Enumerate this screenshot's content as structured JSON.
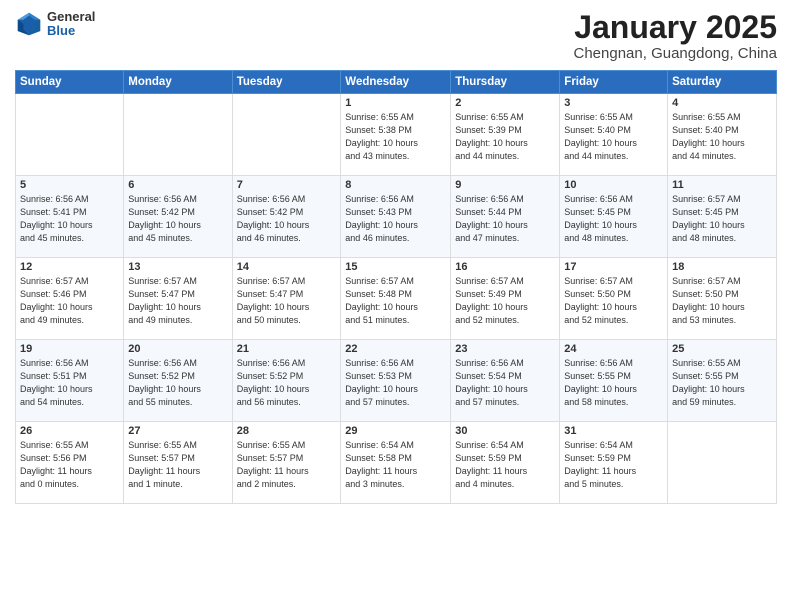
{
  "header": {
    "logo_general": "General",
    "logo_blue": "Blue",
    "month_title": "January 2025",
    "location": "Chengnan, Guangdong, China"
  },
  "weekdays": [
    "Sunday",
    "Monday",
    "Tuesday",
    "Wednesday",
    "Thursday",
    "Friday",
    "Saturday"
  ],
  "weeks": [
    [
      {
        "day": "",
        "info": ""
      },
      {
        "day": "",
        "info": ""
      },
      {
        "day": "",
        "info": ""
      },
      {
        "day": "1",
        "info": "Sunrise: 6:55 AM\nSunset: 5:38 PM\nDaylight: 10 hours\nand 43 minutes."
      },
      {
        "day": "2",
        "info": "Sunrise: 6:55 AM\nSunset: 5:39 PM\nDaylight: 10 hours\nand 44 minutes."
      },
      {
        "day": "3",
        "info": "Sunrise: 6:55 AM\nSunset: 5:40 PM\nDaylight: 10 hours\nand 44 minutes."
      },
      {
        "day": "4",
        "info": "Sunrise: 6:55 AM\nSunset: 5:40 PM\nDaylight: 10 hours\nand 44 minutes."
      }
    ],
    [
      {
        "day": "5",
        "info": "Sunrise: 6:56 AM\nSunset: 5:41 PM\nDaylight: 10 hours\nand 45 minutes."
      },
      {
        "day": "6",
        "info": "Sunrise: 6:56 AM\nSunset: 5:42 PM\nDaylight: 10 hours\nand 45 minutes."
      },
      {
        "day": "7",
        "info": "Sunrise: 6:56 AM\nSunset: 5:42 PM\nDaylight: 10 hours\nand 46 minutes."
      },
      {
        "day": "8",
        "info": "Sunrise: 6:56 AM\nSunset: 5:43 PM\nDaylight: 10 hours\nand 46 minutes."
      },
      {
        "day": "9",
        "info": "Sunrise: 6:56 AM\nSunset: 5:44 PM\nDaylight: 10 hours\nand 47 minutes."
      },
      {
        "day": "10",
        "info": "Sunrise: 6:56 AM\nSunset: 5:45 PM\nDaylight: 10 hours\nand 48 minutes."
      },
      {
        "day": "11",
        "info": "Sunrise: 6:57 AM\nSunset: 5:45 PM\nDaylight: 10 hours\nand 48 minutes."
      }
    ],
    [
      {
        "day": "12",
        "info": "Sunrise: 6:57 AM\nSunset: 5:46 PM\nDaylight: 10 hours\nand 49 minutes."
      },
      {
        "day": "13",
        "info": "Sunrise: 6:57 AM\nSunset: 5:47 PM\nDaylight: 10 hours\nand 49 minutes."
      },
      {
        "day": "14",
        "info": "Sunrise: 6:57 AM\nSunset: 5:47 PM\nDaylight: 10 hours\nand 50 minutes."
      },
      {
        "day": "15",
        "info": "Sunrise: 6:57 AM\nSunset: 5:48 PM\nDaylight: 10 hours\nand 51 minutes."
      },
      {
        "day": "16",
        "info": "Sunrise: 6:57 AM\nSunset: 5:49 PM\nDaylight: 10 hours\nand 52 minutes."
      },
      {
        "day": "17",
        "info": "Sunrise: 6:57 AM\nSunset: 5:50 PM\nDaylight: 10 hours\nand 52 minutes."
      },
      {
        "day": "18",
        "info": "Sunrise: 6:57 AM\nSunset: 5:50 PM\nDaylight: 10 hours\nand 53 minutes."
      }
    ],
    [
      {
        "day": "19",
        "info": "Sunrise: 6:56 AM\nSunset: 5:51 PM\nDaylight: 10 hours\nand 54 minutes."
      },
      {
        "day": "20",
        "info": "Sunrise: 6:56 AM\nSunset: 5:52 PM\nDaylight: 10 hours\nand 55 minutes."
      },
      {
        "day": "21",
        "info": "Sunrise: 6:56 AM\nSunset: 5:52 PM\nDaylight: 10 hours\nand 56 minutes."
      },
      {
        "day": "22",
        "info": "Sunrise: 6:56 AM\nSunset: 5:53 PM\nDaylight: 10 hours\nand 57 minutes."
      },
      {
        "day": "23",
        "info": "Sunrise: 6:56 AM\nSunset: 5:54 PM\nDaylight: 10 hours\nand 57 minutes."
      },
      {
        "day": "24",
        "info": "Sunrise: 6:56 AM\nSunset: 5:55 PM\nDaylight: 10 hours\nand 58 minutes."
      },
      {
        "day": "25",
        "info": "Sunrise: 6:55 AM\nSunset: 5:55 PM\nDaylight: 10 hours\nand 59 minutes."
      }
    ],
    [
      {
        "day": "26",
        "info": "Sunrise: 6:55 AM\nSunset: 5:56 PM\nDaylight: 11 hours\nand 0 minutes."
      },
      {
        "day": "27",
        "info": "Sunrise: 6:55 AM\nSunset: 5:57 PM\nDaylight: 11 hours\nand 1 minute."
      },
      {
        "day": "28",
        "info": "Sunrise: 6:55 AM\nSunset: 5:57 PM\nDaylight: 11 hours\nand 2 minutes."
      },
      {
        "day": "29",
        "info": "Sunrise: 6:54 AM\nSunset: 5:58 PM\nDaylight: 11 hours\nand 3 minutes."
      },
      {
        "day": "30",
        "info": "Sunrise: 6:54 AM\nSunset: 5:59 PM\nDaylight: 11 hours\nand 4 minutes."
      },
      {
        "day": "31",
        "info": "Sunrise: 6:54 AM\nSunset: 5:59 PM\nDaylight: 11 hours\nand 5 minutes."
      },
      {
        "day": "",
        "info": ""
      }
    ]
  ]
}
